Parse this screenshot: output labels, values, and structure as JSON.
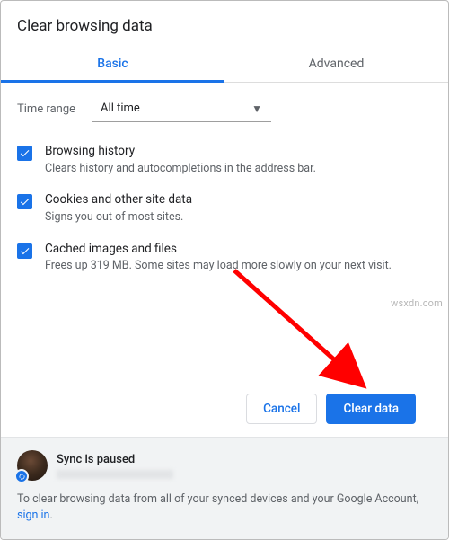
{
  "dialog": {
    "title": "Clear browsing data"
  },
  "tabs": {
    "basic": "Basic",
    "advanced": "Advanced"
  },
  "timerange": {
    "label": "Time range",
    "selected": "All time"
  },
  "options": {
    "history": {
      "title": "Browsing history",
      "desc": "Clears history and autocompletions in the address bar."
    },
    "cookies": {
      "title": "Cookies and other site data",
      "desc": "Signs you out of most sites."
    },
    "cache": {
      "title": "Cached images and files",
      "desc": "Frees up 319 MB. Some sites may load more slowly on your next visit."
    }
  },
  "actions": {
    "cancel": "Cancel",
    "clear": "Clear data"
  },
  "footer": {
    "sync_status": "Sync is paused",
    "note_prefix": "To clear browsing data from all of your synced devices and your Google Account, ",
    "signin": "sign in",
    "note_suffix": "."
  },
  "watermark": "wsxdn.com"
}
